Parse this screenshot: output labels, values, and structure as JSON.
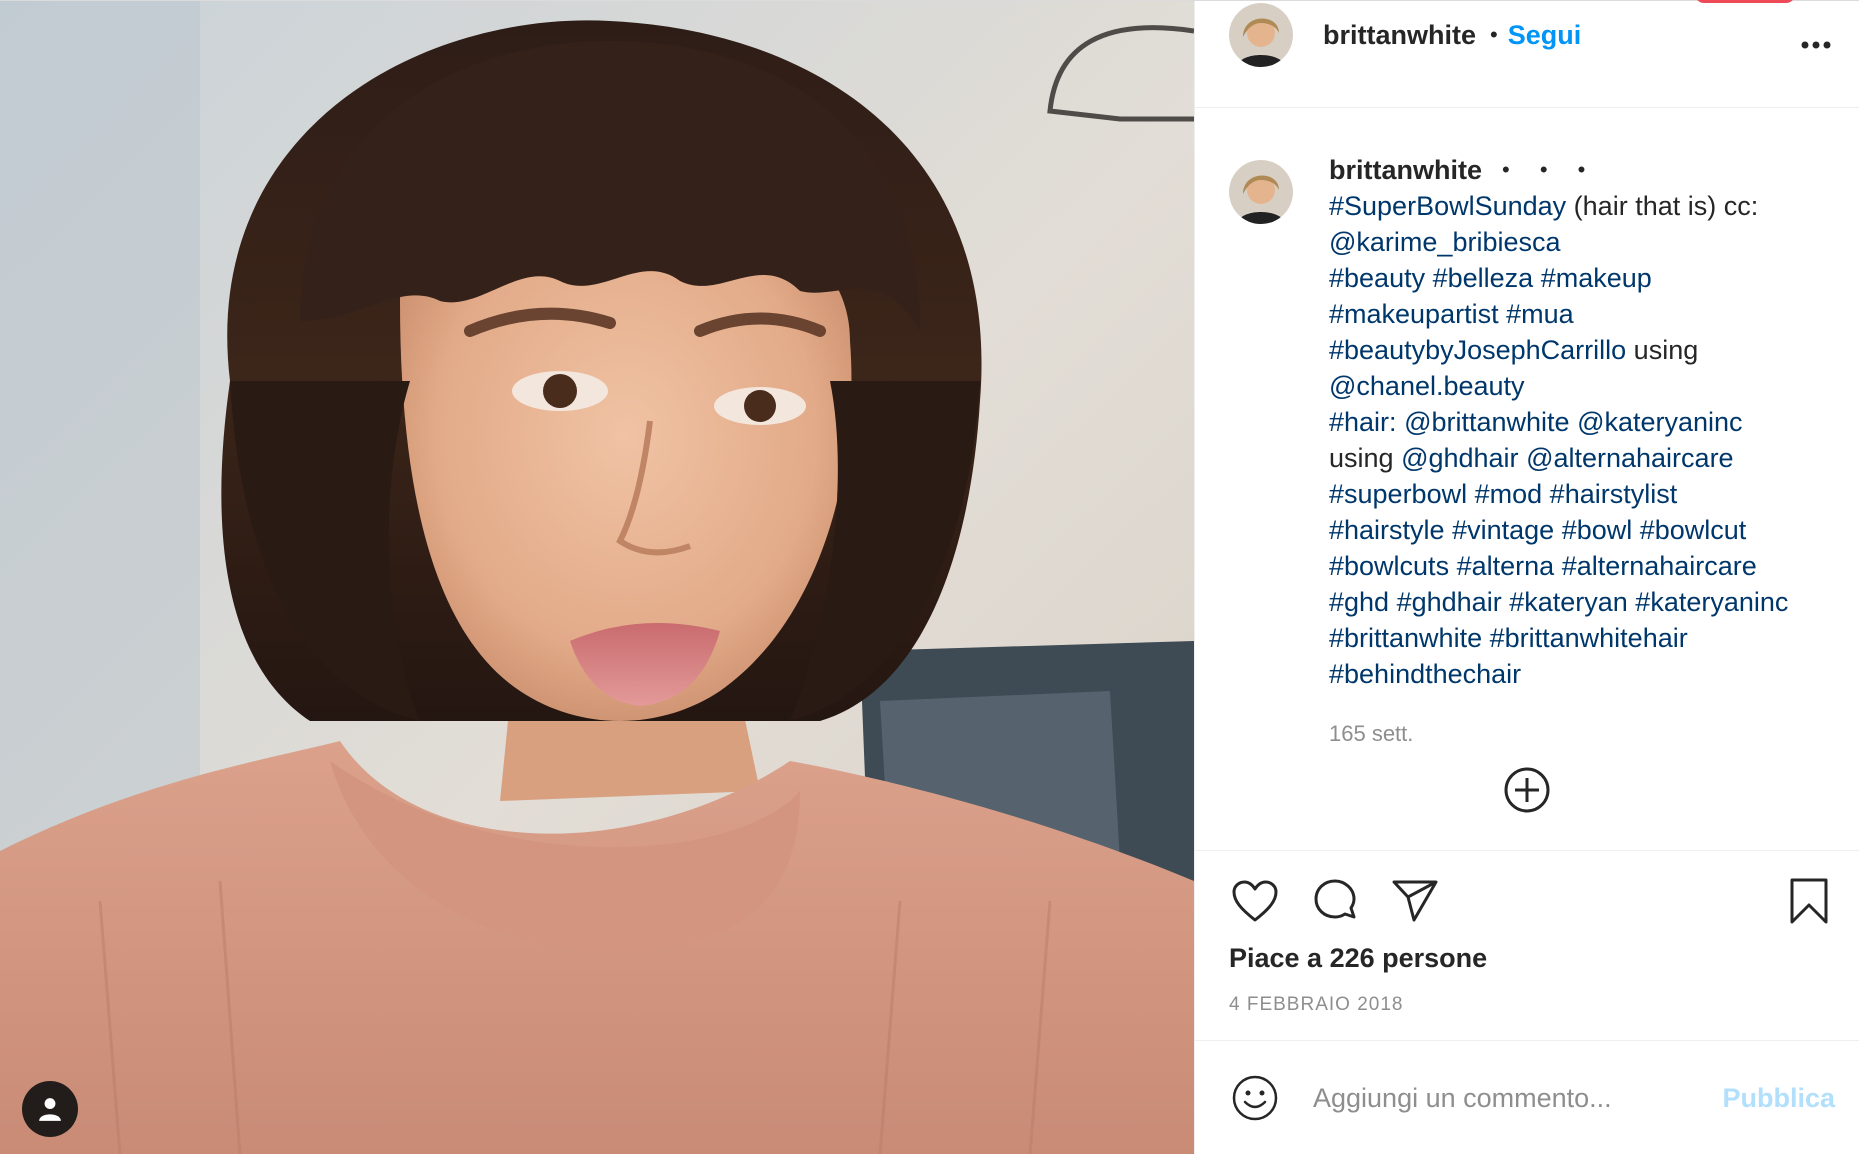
{
  "post": {
    "photo_alt": "",
    "tag_icon": "user-icon"
  },
  "header": {
    "username": "brittanwhite",
    "separator": "•",
    "follow_label": "Segui",
    "more_icon": "more-horizontal-icon",
    "more_label": "•••"
  },
  "caption": {
    "username": "brittanwhite",
    "dots": "• • •",
    "lines": [
      [
        {
          "t": "#SuperBowlSunday",
          "link": true
        },
        {
          "t": " (hair that is) cc:",
          "link": false
        }
      ],
      [
        {
          "t": "@karime_bribiesca",
          "link": true
        }
      ],
      [
        {
          "t": "#beauty",
          "link": true
        },
        {
          "t": " ",
          "link": false
        },
        {
          "t": "#belleza",
          "link": true
        },
        {
          "t": " ",
          "link": false
        },
        {
          "t": "#makeup",
          "link": true
        }
      ],
      [
        {
          "t": "#makeupartist",
          "link": true
        },
        {
          "t": " ",
          "link": false
        },
        {
          "t": "#mua",
          "link": true
        }
      ],
      [
        {
          "t": "#beautybyJosephCarrillo",
          "link": true
        },
        {
          "t": " using",
          "link": false
        }
      ],
      [
        {
          "t": "@chanel.beauty",
          "link": true
        }
      ],
      [
        {
          "t": "#hair:",
          "link": true
        },
        {
          "t": " ",
          "link": false
        },
        {
          "t": "@brittanwhite",
          "link": true
        },
        {
          "t": " ",
          "link": false
        },
        {
          "t": "@kateryaninc",
          "link": true
        }
      ],
      [
        {
          "t": "using ",
          "link": false
        },
        {
          "t": "@ghdhair",
          "link": true
        },
        {
          "t": " ",
          "link": false
        },
        {
          "t": "@alternahaircare",
          "link": true
        }
      ],
      [
        {
          "t": "#superbowl",
          "link": true
        },
        {
          "t": " ",
          "link": false
        },
        {
          "t": "#mod",
          "link": true
        },
        {
          "t": " ",
          "link": false
        },
        {
          "t": "#hairstylist",
          "link": true
        }
      ],
      [
        {
          "t": "#hairstyle",
          "link": true
        },
        {
          "t": " ",
          "link": false
        },
        {
          "t": "#vintage",
          "link": true
        },
        {
          "t": " ",
          "link": false
        },
        {
          "t": "#bowl",
          "link": true
        },
        {
          "t": " ",
          "link": false
        },
        {
          "t": "#bowlcut",
          "link": true
        }
      ],
      [
        {
          "t": "#bowlcuts",
          "link": true
        },
        {
          "t": " ",
          "link": false
        },
        {
          "t": "#alterna",
          "link": true
        },
        {
          "t": " ",
          "link": false
        },
        {
          "t": "#alternahaircare",
          "link": true
        }
      ],
      [
        {
          "t": "#ghd",
          "link": true
        },
        {
          "t": " ",
          "link": false
        },
        {
          "t": "#ghdhair",
          "link": true
        },
        {
          "t": " ",
          "link": false
        },
        {
          "t": "#kateryan",
          "link": true
        },
        {
          "t": " ",
          "link": false
        },
        {
          "t": "#kateryaninc",
          "link": true
        }
      ],
      [
        {
          "t": "#brittanwhite",
          "link": true
        },
        {
          "t": " ",
          "link": false
        },
        {
          "t": "#brittanwhitehair",
          "link": true
        }
      ],
      [
        {
          "t": "#behindthechair",
          "link": true
        }
      ]
    ],
    "time_ago": "165 sett."
  },
  "load_more_icon": "plus-circle-icon",
  "actions": {
    "like_icon": "heart-icon",
    "comment_icon": "comment-icon",
    "share_icon": "paper-plane-icon",
    "save_icon": "bookmark-icon"
  },
  "likes_text": "Piace a 226 persone",
  "date_text": "4 febbraio 2018",
  "comment_bar": {
    "emoji_icon": "smiley-icon",
    "placeholder": "Aggiungi un commento...",
    "publish_label": "Pubblica"
  },
  "colors": {
    "link": "#00376b",
    "follow": "#0095f6",
    "publish_disabled": "#b2dffc",
    "muted": "#8e8e8e",
    "notification": "#ed4956"
  }
}
